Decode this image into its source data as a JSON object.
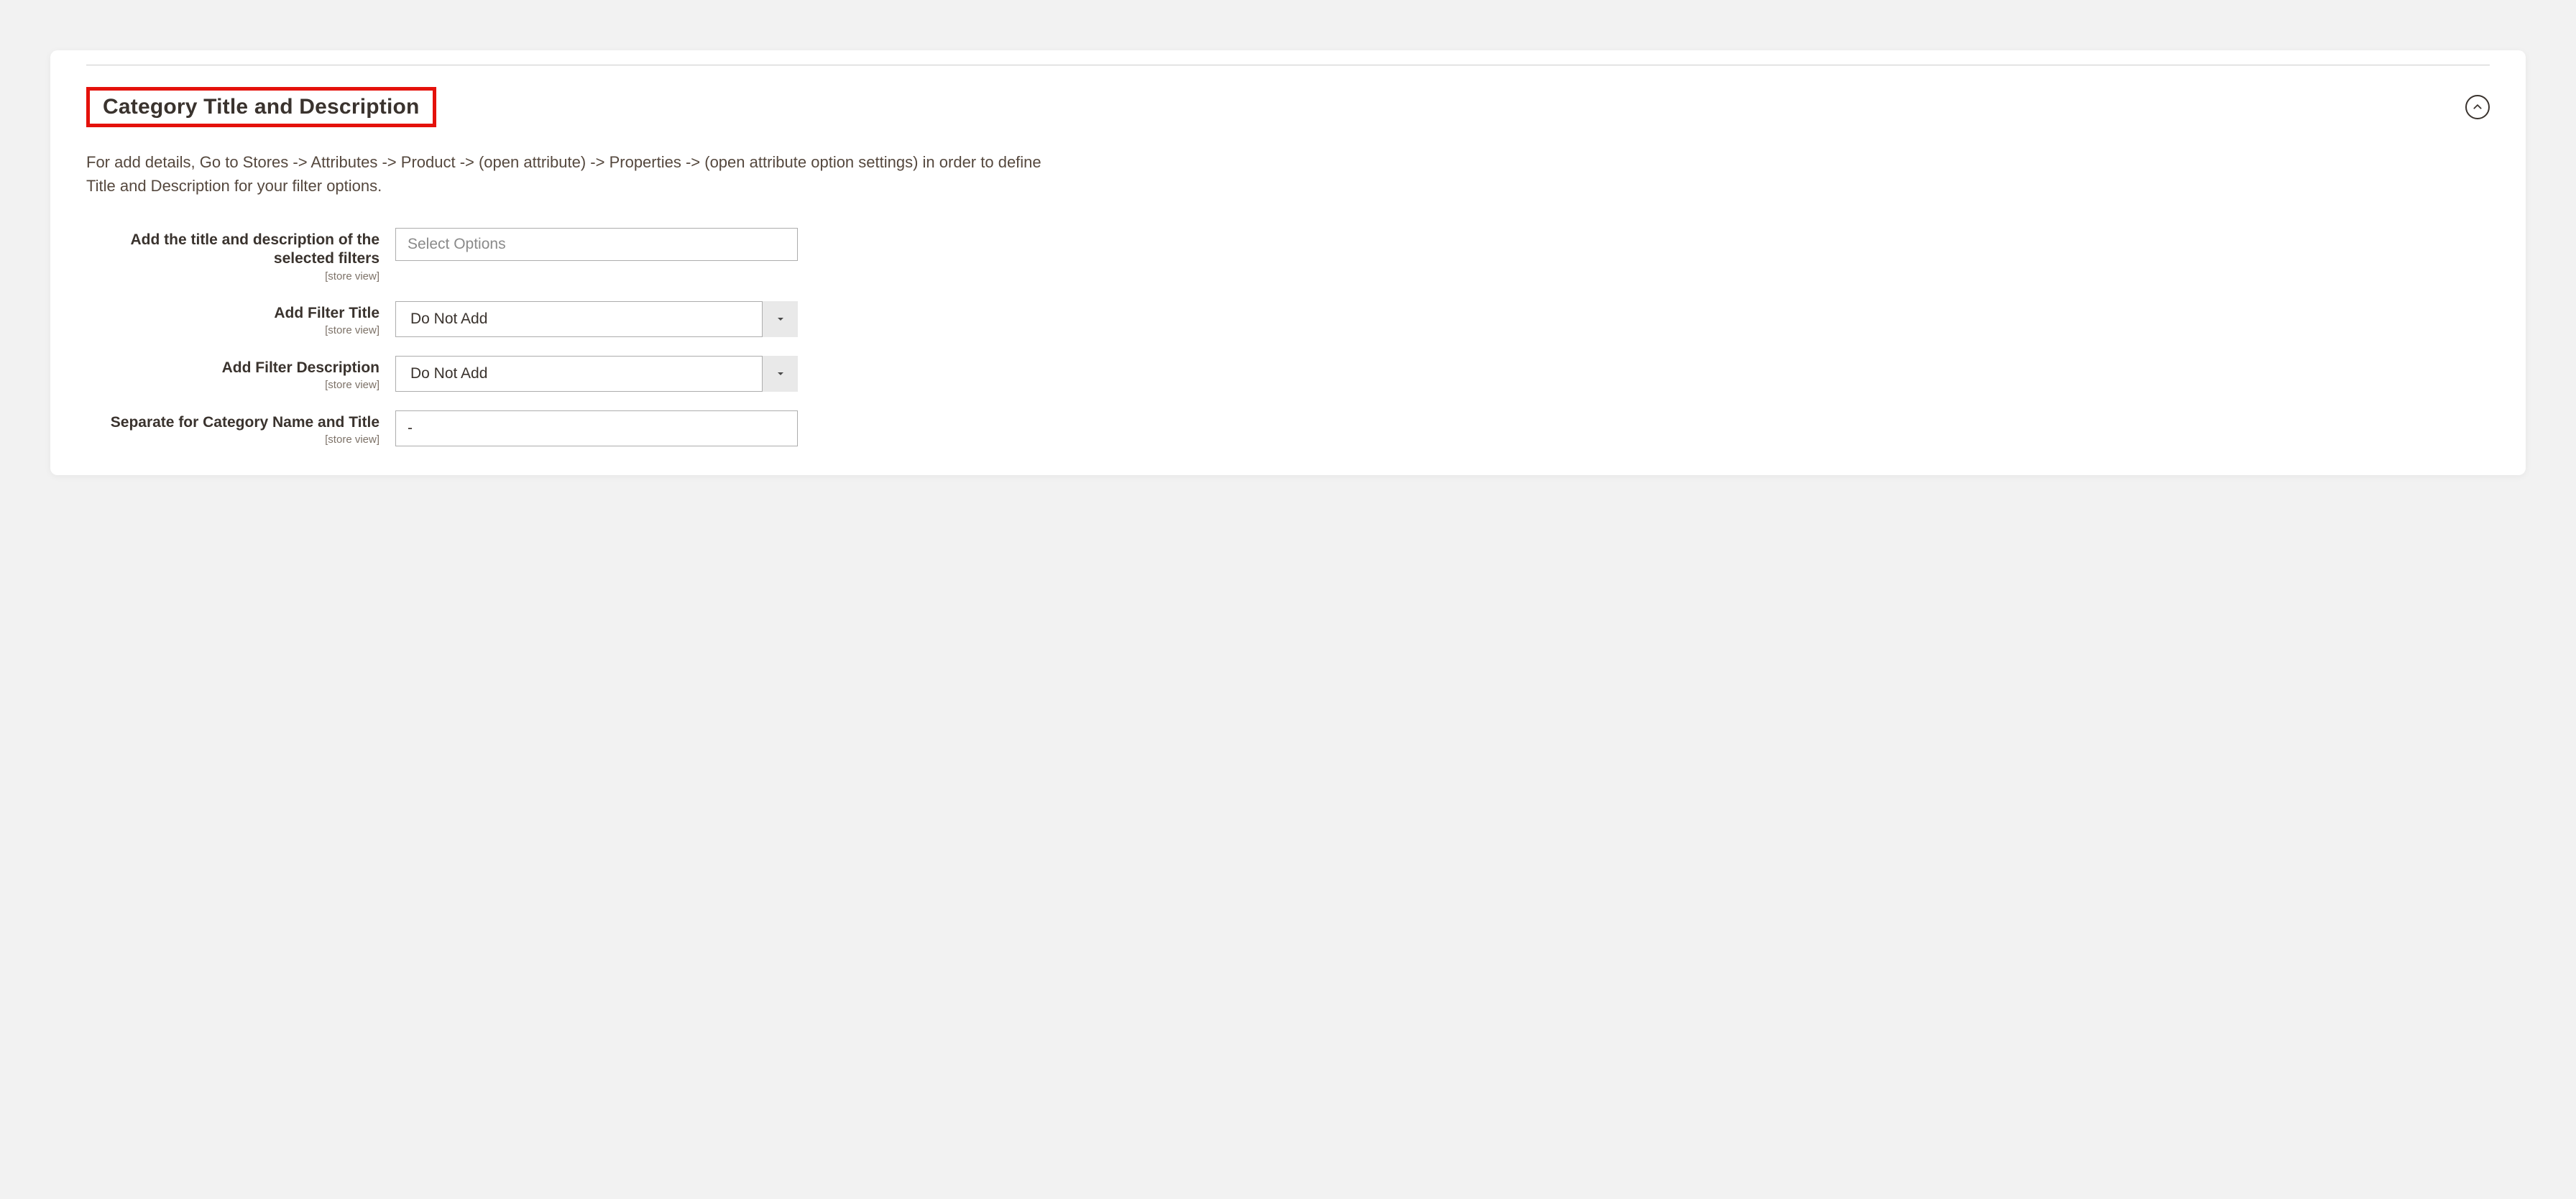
{
  "section": {
    "title": "Category Title and Description",
    "help_text": "For add details, Go to Stores -> Attributes -> Product -> (open attribute) -> Properties -> (open attribute option settings) in order to define Title and Description for your filter options."
  },
  "fields": {
    "selected_filters": {
      "label": "Add the title and description of the selected filters",
      "scope": "[store view]",
      "placeholder": "Select Options"
    },
    "add_filter_title": {
      "label": "Add Filter Title",
      "scope": "[store view]",
      "value": "Do Not Add"
    },
    "add_filter_description": {
      "label": "Add Filter Description",
      "scope": "[store view]",
      "value": "Do Not Add"
    },
    "separator": {
      "label": "Separate for Category Name and Title",
      "scope": "[store view]",
      "value": "-"
    }
  }
}
